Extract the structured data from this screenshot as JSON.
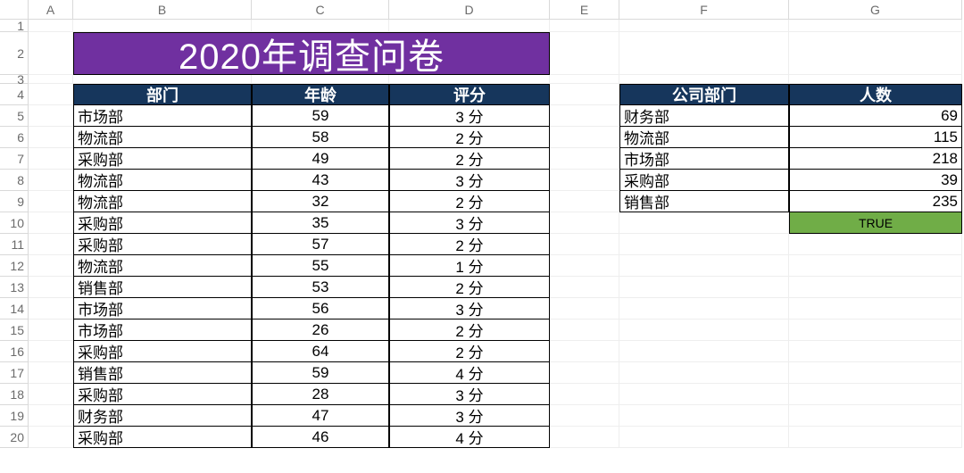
{
  "columns": [
    "A",
    "B",
    "C",
    "D",
    "E",
    "F",
    "G"
  ],
  "row_numbers": [
    1,
    2,
    3,
    4,
    5,
    6,
    7,
    8,
    9,
    10,
    11,
    12,
    13,
    14,
    15,
    16,
    17,
    18,
    19,
    20
  ],
  "title": "2020年调查问卷",
  "main_table": {
    "headers": {
      "dept": "部门",
      "age": "年龄",
      "score": "评分"
    },
    "rows": [
      {
        "dept": "市场部",
        "age": 59,
        "score": "3 分"
      },
      {
        "dept": "物流部",
        "age": 58,
        "score": "2 分"
      },
      {
        "dept": "采购部",
        "age": 49,
        "score": "2 分"
      },
      {
        "dept": "物流部",
        "age": 43,
        "score": "3 分"
      },
      {
        "dept": "物流部",
        "age": 32,
        "score": "2 分"
      },
      {
        "dept": "采购部",
        "age": 35,
        "score": "3 分"
      },
      {
        "dept": "采购部",
        "age": 57,
        "score": "2 分"
      },
      {
        "dept": "物流部",
        "age": 55,
        "score": "1 分"
      },
      {
        "dept": "销售部",
        "age": 53,
        "score": "2 分"
      },
      {
        "dept": "市场部",
        "age": 56,
        "score": "3 分"
      },
      {
        "dept": "市场部",
        "age": 26,
        "score": "2 分"
      },
      {
        "dept": "采购部",
        "age": 64,
        "score": "2 分"
      },
      {
        "dept": "销售部",
        "age": 59,
        "score": "4 分"
      },
      {
        "dept": "采购部",
        "age": 28,
        "score": "3 分"
      },
      {
        "dept": "财务部",
        "age": 47,
        "score": "3 分"
      },
      {
        "dept": "采购部",
        "age": 46,
        "score": "4 分"
      }
    ]
  },
  "summary_table": {
    "headers": {
      "dept": "公司部门",
      "count": "人数"
    },
    "rows": [
      {
        "dept": "财务部",
        "count": 69
      },
      {
        "dept": "物流部",
        "count": 115
      },
      {
        "dept": "市场部",
        "count": 218
      },
      {
        "dept": "采购部",
        "count": 39
      },
      {
        "dept": "销售部",
        "count": 235
      }
    ],
    "true_label": "TRUE"
  }
}
